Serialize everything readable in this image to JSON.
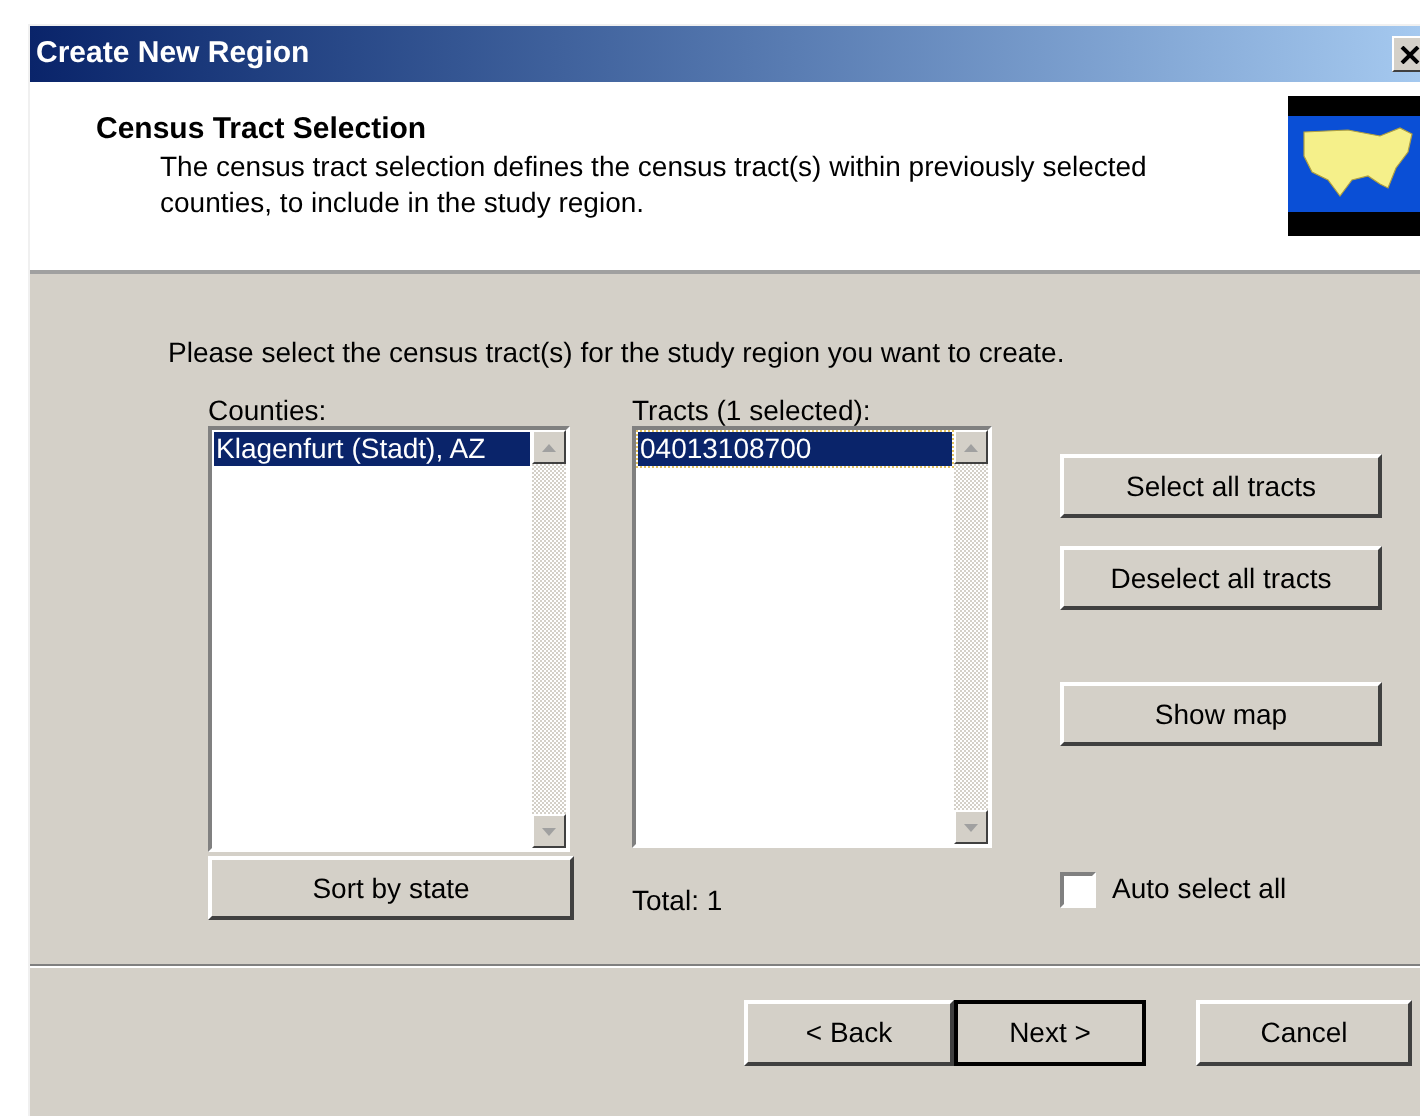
{
  "window": {
    "title": "Create New Region"
  },
  "header": {
    "title": "Census Tract Selection",
    "description": "The census tract selection defines the census tract(s) within previously selected counties, to include in the study region."
  },
  "instruction": "Please select the census tract(s) for the study region you want to create.",
  "counties": {
    "label": "Counties:",
    "items": [
      {
        "text": "Klagenfurt (Stadt), AZ",
        "selected": true
      }
    ],
    "button": "Sort by state"
  },
  "tracts": {
    "label": "Tracts (1 selected):",
    "items": [
      {
        "text": "04013108700",
        "selected": true
      }
    ],
    "total": "Total: 1"
  },
  "actions": [
    "Select all tracts",
    "Deselect all tracts",
    "Show map"
  ],
  "auto_select": {
    "label": "Auto select all",
    "checked": false
  },
  "footer_buttons": [
    {
      "label": "< Back",
      "default": false
    },
    {
      "label": "Next >",
      "default": true
    },
    {
      "label": "Cancel",
      "default": false
    }
  ]
}
